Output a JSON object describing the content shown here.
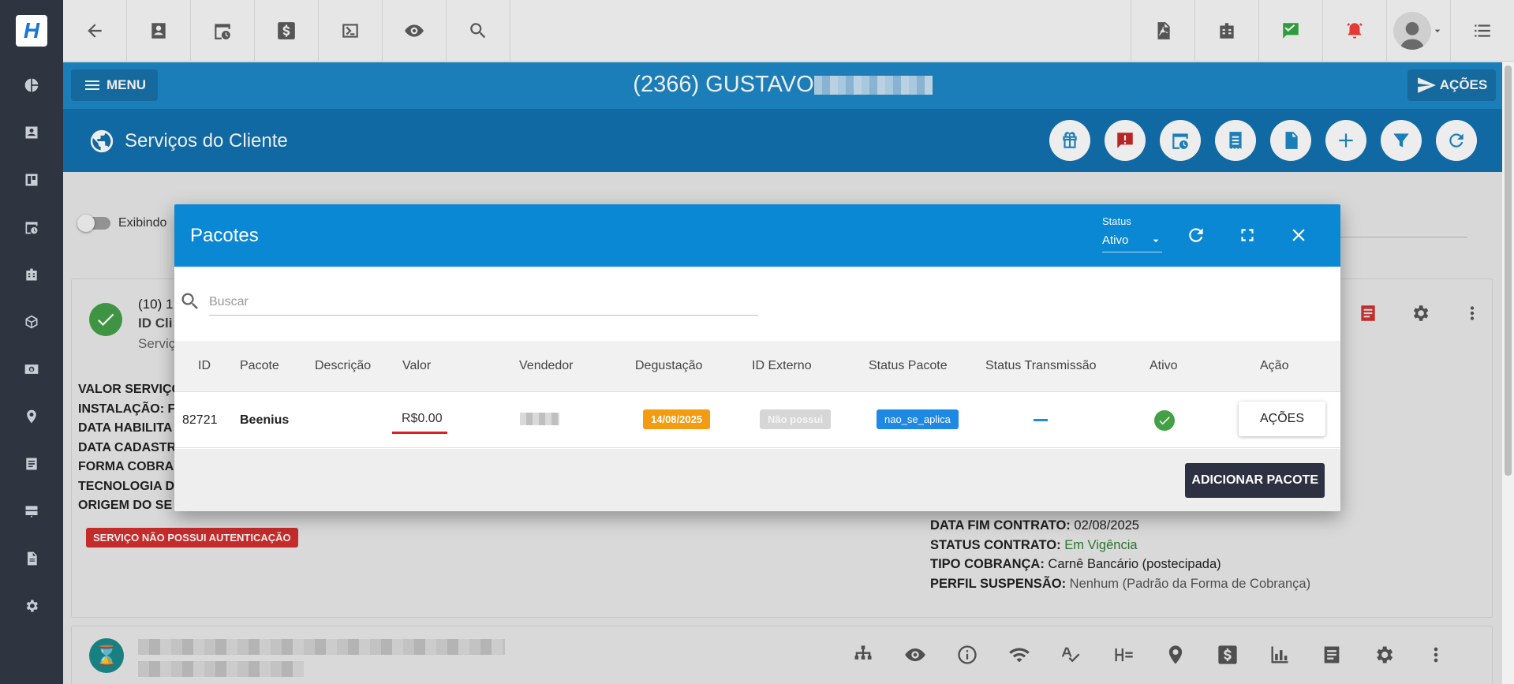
{
  "app": {
    "logo_letter": "H"
  },
  "header": {
    "menu_label": "MENU",
    "client_title": "(2366) GUSTAVO",
    "acoes_label": "AÇÕES",
    "section_title": "Serviços do Cliente"
  },
  "content": {
    "toggle_label": "Exibindo",
    "card": {
      "line1": "(10) 1",
      "line2": "ID Cli",
      "line3": "Serviç",
      "left_info": [
        "VALOR SERVIÇO",
        "INSTALAÇÃO: F",
        "DATA HABILITA",
        "DATA CADASTR",
        "FORMA COBRA",
        "TECNOLOGIA D",
        "ORIGEM DO SE"
      ],
      "auth_badge": "SERVIÇO NÃO POSSUI AUTENTICAÇÃO",
      "right_info": [
        {
          "label": "DATA FIM CONTRATO:",
          "value": "02/08/2025",
          "color": "#333333"
        },
        {
          "label": "STATUS CONTRATO:",
          "value": "Em Vigência",
          "color": "#2e7d32"
        },
        {
          "label": "TIPO COBRANÇA:",
          "value": "Carnê Bancário (postecipada)",
          "color": "#333333"
        },
        {
          "label": "PERFIL SUSPENSÃO:",
          "value": "Nenhum (Padrão da Forma de Cobrança)",
          "color": "#555555"
        }
      ]
    }
  },
  "modal": {
    "title": "Pacotes",
    "status_label": "Status",
    "status_value": "Ativo",
    "search_placeholder": "Buscar",
    "columns": [
      "ID",
      "Pacote",
      "Descrição",
      "Valor",
      "Vendedor",
      "Degustação",
      "ID Externo",
      "Status Pacote",
      "Status Transmissão",
      "Ativo",
      "Ação"
    ],
    "row": {
      "id": "82721",
      "pacote": "Beenius",
      "descricao": "",
      "valor": "R$0.00",
      "degustacao": "14/08/2025",
      "id_externo": "Não possui",
      "status_pacote": "nao_se_aplica",
      "acao_label": "AÇÕES"
    },
    "add_label": "ADICIONAR PACOTE"
  },
  "colors": {
    "modal_header": "#0b88d3",
    "degustacao_chip": "#f39c12",
    "id_externo_chip": "#d6d6d6",
    "status_pacote_chip": "#1e88e5",
    "ativo_check": "#43a047"
  }
}
